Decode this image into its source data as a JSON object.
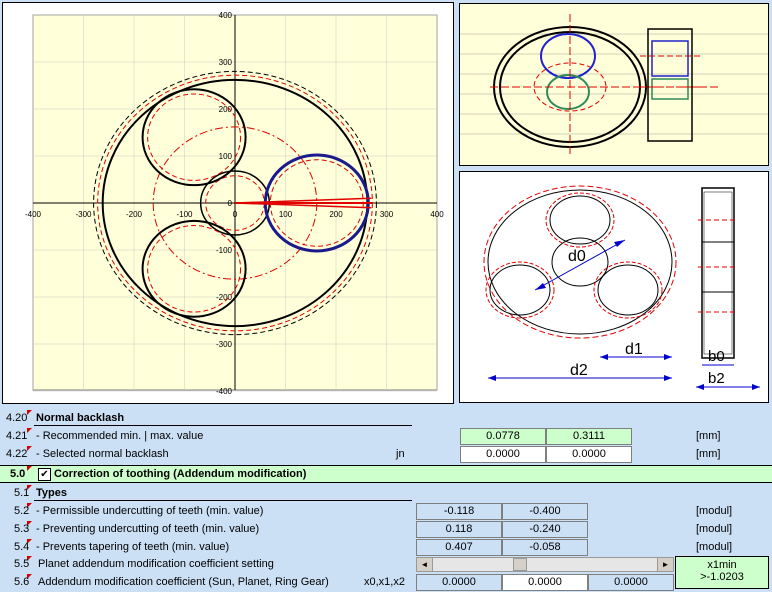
{
  "chart": {
    "x_ticks": [
      "-400",
      "-300",
      "-200",
      "-100",
      "0",
      "100",
      "200",
      "300",
      "400"
    ],
    "y_ticks": [
      "400",
      "300",
      "200",
      "100",
      "0",
      "-100",
      "-200",
      "-300",
      "-400"
    ]
  },
  "chart_data": {
    "type": "scatter",
    "xlim": [
      -400,
      400
    ],
    "ylim": [
      -400,
      400
    ],
    "grid": true,
    "series": [
      {
        "shape": "ring_gear_outer",
        "center": [
          0,
          0
        ],
        "radius": 262
      },
      {
        "shape": "ring_gear_tip",
        "center": [
          0,
          0
        ],
        "radius": 272
      },
      {
        "shape": "sun_gear",
        "center": [
          0,
          0
        ],
        "radius": 68
      },
      {
        "shape": "planet_1",
        "center": [
          162,
          0
        ],
        "radius": 102
      },
      {
        "shape": "planet_2",
        "center": [
          -81,
          140
        ],
        "radius": 102
      },
      {
        "shape": "planet_3",
        "center": [
          -81,
          -140
        ],
        "radius": 102
      },
      {
        "shape": "carrier_pitch_circle",
        "center": [
          0,
          0
        ],
        "radius": 162
      }
    ]
  },
  "diagram": {
    "d0": "d0",
    "d1": "d1",
    "d2": "d2",
    "b0": "b0",
    "b2": "b2"
  },
  "rows": [
    {
      "num": "4.20",
      "label": "Normal backlash",
      "section": true
    },
    {
      "num": "4.21",
      "label": " - Recommended min. | max. value",
      "v1": "0.0778",
      "v2": "0.3111",
      "unit": "[mm]"
    },
    {
      "num": "4.22",
      "label": " - Selected normal backlash",
      "sym": "jn",
      "v1": "0.0000",
      "v2": "0.0000",
      "unit": "[mm]"
    },
    {
      "num": "5.0",
      "label": "Correction of toothing (Addendum modification)",
      "checkbox": "✔"
    },
    {
      "num": "5.1",
      "label": "Types",
      "section": true
    },
    {
      "num": "5.2",
      "label": " - Permissible undercutting of teeth (min. value)",
      "v1": "-0.118",
      "v2": "-0.400",
      "unit": "[modul]"
    },
    {
      "num": "5.3",
      "label": " - Preventing undercutting of teeth (min. value)",
      "v1": "0.118",
      "v2": "-0.240",
      "unit": "[modul]"
    },
    {
      "num": "5.4",
      "label": " - Prevents tapering of teeth (min. value)",
      "v1": "0.407",
      "v2": "-0.058",
      "unit": "[modul]"
    },
    {
      "num": "5.5",
      "label": "Planet addendum modification coefficient setting",
      "info1": "x1min",
      "info2": ">-1.0203"
    },
    {
      "num": "5.6",
      "label": "Addendum modification coefficient (Sun, Planet, Ring Gear)",
      "sym": "x0,x1,x2",
      "v1": "0.0000",
      "v2": "0.0000",
      "v3": "0.0000"
    }
  ],
  "scrollbar": {
    "left_arrow": "◄",
    "right_arrow": "►",
    "position": 0.38
  },
  "colors": {
    "background": "#cce0f5",
    "plot_bg": "#ffffd9",
    "green_cell": "#ccffcc",
    "header_green": "#ccffcc",
    "red": "#e00000",
    "blue": "#1a1a8c"
  }
}
